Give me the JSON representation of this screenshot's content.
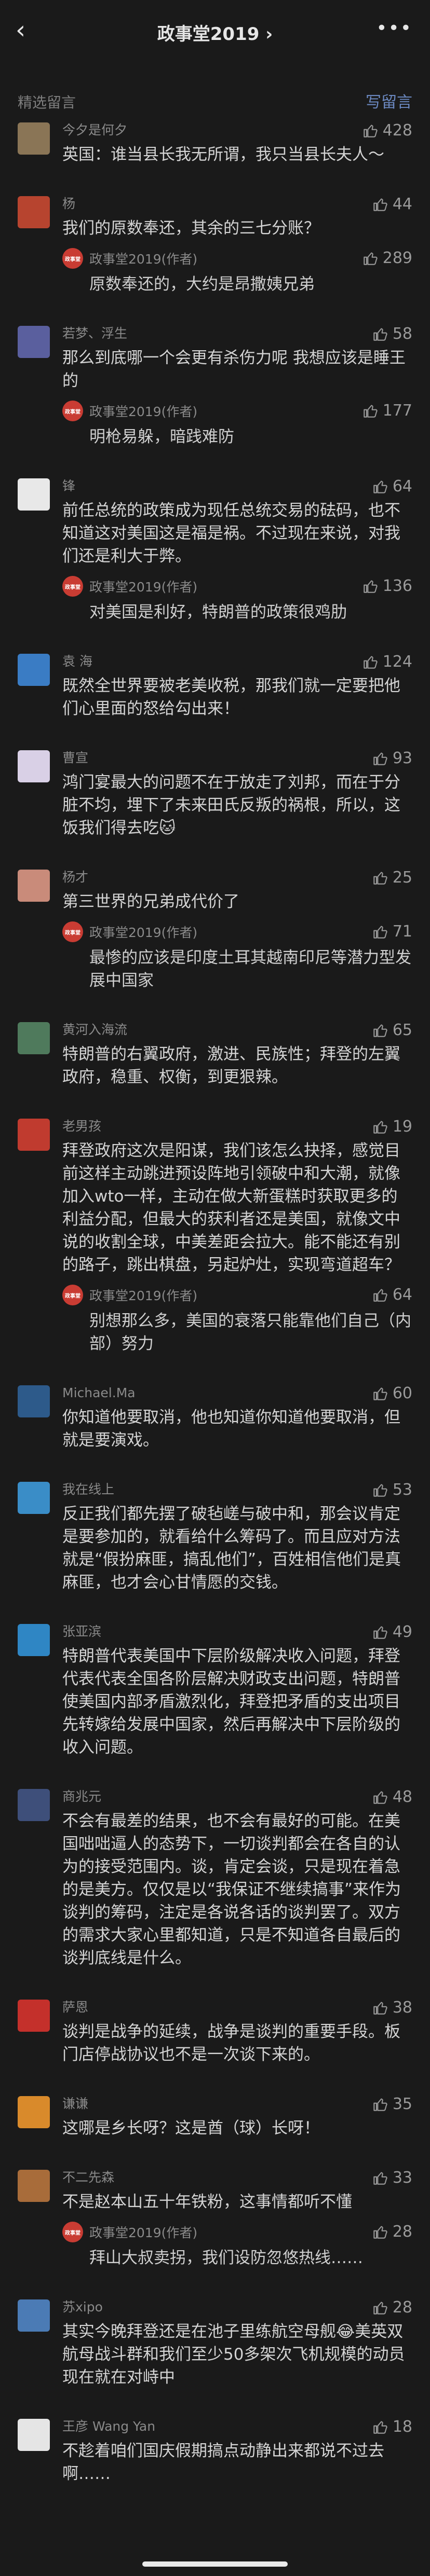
{
  "header": {
    "back": "‹",
    "title": "政事堂2019 ›",
    "more": "•••"
  },
  "section": {
    "label": "精选留言",
    "write": "写留言"
  },
  "comments": [
    {
      "user": "今夕是何夕",
      "likes": "428",
      "text": "英国：谁当县长我无所谓，我只当县长夫人～",
      "avatar_color": "#8a7556"
    },
    {
      "user": "杨",
      "likes": "44",
      "text": "我们的原数奉还，其余的三七分账？",
      "reply": {
        "author": "政事堂2019(作者)",
        "likes": "289",
        "text": "原数奉还的，大约是昂撒姨兄弟"
      },
      "avatar_color": "#b7442f"
    },
    {
      "user": "若梦、浮生",
      "likes": "58",
      "text": "那么到底哪一个会更有杀伤力呢 我想应该是睡王的",
      "reply": {
        "author": "政事堂2019(作者)",
        "likes": "177",
        "text": "明枪易躲，暗践难防"
      },
      "avatar_color": "#5a5f9e"
    },
    {
      "user": "锋",
      "likes": "64",
      "text": "前任总统的政策成为现任总统交易的砝码，也不知道这对美国这是福是祸。不过现在来说，对我们还是利大于弊。",
      "reply": {
        "author": "政事堂2019(作者)",
        "likes": "136",
        "text": "对美国是利好，特朗普的政策很鸡肋"
      },
      "avatar_color": "#e8e8e8"
    },
    {
      "user": "袁 海",
      "likes": "124",
      "text": "既然全世界要被老美收税，那我们就一定要把他们心里面的怒给勾出来！",
      "avatar_color": "#3a7cc4"
    },
    {
      "user": "曹宣",
      "likes": "93",
      "text": "鸿门宴最大的问题不在于放走了刘邦，而在于分脏不均，埋下了未来田氏反叛的祸根，所以，这饭我们得去吃🐱",
      "avatar_color": "#d9d0e6"
    },
    {
      "user": "杨才",
      "likes": "25",
      "text": "第三世界的兄弟成代价了",
      "reply": {
        "author": "政事堂2019(作者)",
        "likes": "71",
        "text": "最惨的应该是印度土耳其越南印尼等潜力型发展中国家"
      },
      "avatar_color": "#c98b7a"
    },
    {
      "user": "黄河入海流",
      "likes": "65",
      "text": "特朗普的右翼政府，激进、民族性；拜登的左翼政府，稳重、权衡，到更狠辣。",
      "avatar_color": "#4f7a5c"
    },
    {
      "user": "老男孩",
      "likes": "19",
      "text": "拜登政府这次是阳谋，我们该怎么抉择，感觉目前这样主动跳进预设阵地引领破中和大潮，就像加入wto一样，主动在做大新蛋糕时获取更多的利益分配，但最大的获利者还是美国，就像文中说的收割全球，中美差距会拉大。能不能还有别的路子，跳出棋盘，另起炉灶，实现弯道超车？",
      "reply": {
        "author": "政事堂2019(作者)",
        "likes": "64",
        "text": "别想那么多，美国的衰落只能靠他们自己（内部）努力"
      },
      "avatar_color": "#c03b2f"
    },
    {
      "user": "Michael.Ma",
      "likes": "60",
      "text": "你知道他要取消，他也知道你知道他要取消，但就是要演戏。",
      "avatar_color": "#2d5a8a"
    },
    {
      "user": "我在线上",
      "likes": "53",
      "text": "反正我们都先摆了破毡嵯与破中和，那会议肯定是要参加的，就看给什么筹码了。而且应对方法就是“假扮麻匪，搞乱他们”，百姓相信他们是真麻匪，也才会心甘情愿的交钱。",
      "avatar_color": "#3a8dc7"
    },
    {
      "user": "张亚滨",
      "likes": "49",
      "text": "特朗普代表美国中下层阶级解决收入问题，拜登代表代表全国各阶层解决财政支出问题，特朗普使美国内部矛盾激烈化，拜登把矛盾的支出项目先转嫁给发展中国家，然后再解决中下层阶级的收入问题。",
      "avatar_color": "#2f86c4"
    },
    {
      "user": "商兆元",
      "likes": "48",
      "text": "不会有最差的结果，也不会有最好的可能。在美国咄咄逼人的态势下，一切谈判都会在各自的认为的接受范围内。谈，肯定会谈，只是现在着急的是美方。仅仅是以“我保证不继续搞事”来作为谈判的筹码，注定是各说各话的谈判罢了。双方的需求大家心里都知道，只是不知道各自最后的谈判底线是什么。",
      "avatar_color": "#3e4f7a"
    },
    {
      "user": "萨恩",
      "likes": "38",
      "text": "谈判是战争的延续，战争是谈判的重要手段。板门店停战协议也不是一次谈下来的。",
      "avatar_color": "#c4302b"
    },
    {
      "user": "谦谦",
      "likes": "35",
      "text": "这哪是乡长呀？这是酋（球）长呀！",
      "avatar_color": "#d98a2b"
    },
    {
      "user": "不二先森",
      "likes": "33",
      "text": "不是赵本山五十年铁粉，这事情都听不懂",
      "reply": {
        "author": "政事堂2019(作者)",
        "likes": "28",
        "text": "拜山大叔卖拐，我们设防忽悠热线……"
      },
      "avatar_color": "#a86c3a"
    },
    {
      "user": "苏xipo",
      "likes": "28",
      "text": "其实今晚拜登还是在池子里练航空母舰😂美英双航母战斗群和我们至少50多架次飞机规模的动员现在就在对峙中",
      "avatar_color": "#4b7bb5"
    },
    {
      "user": "王彦 Wang Yan",
      "likes": "18",
      "text": "不趁着咱们国庆假期搞点动静出来都说不过去啊……",
      "avatar_color": "#e5e5e5"
    }
  ]
}
